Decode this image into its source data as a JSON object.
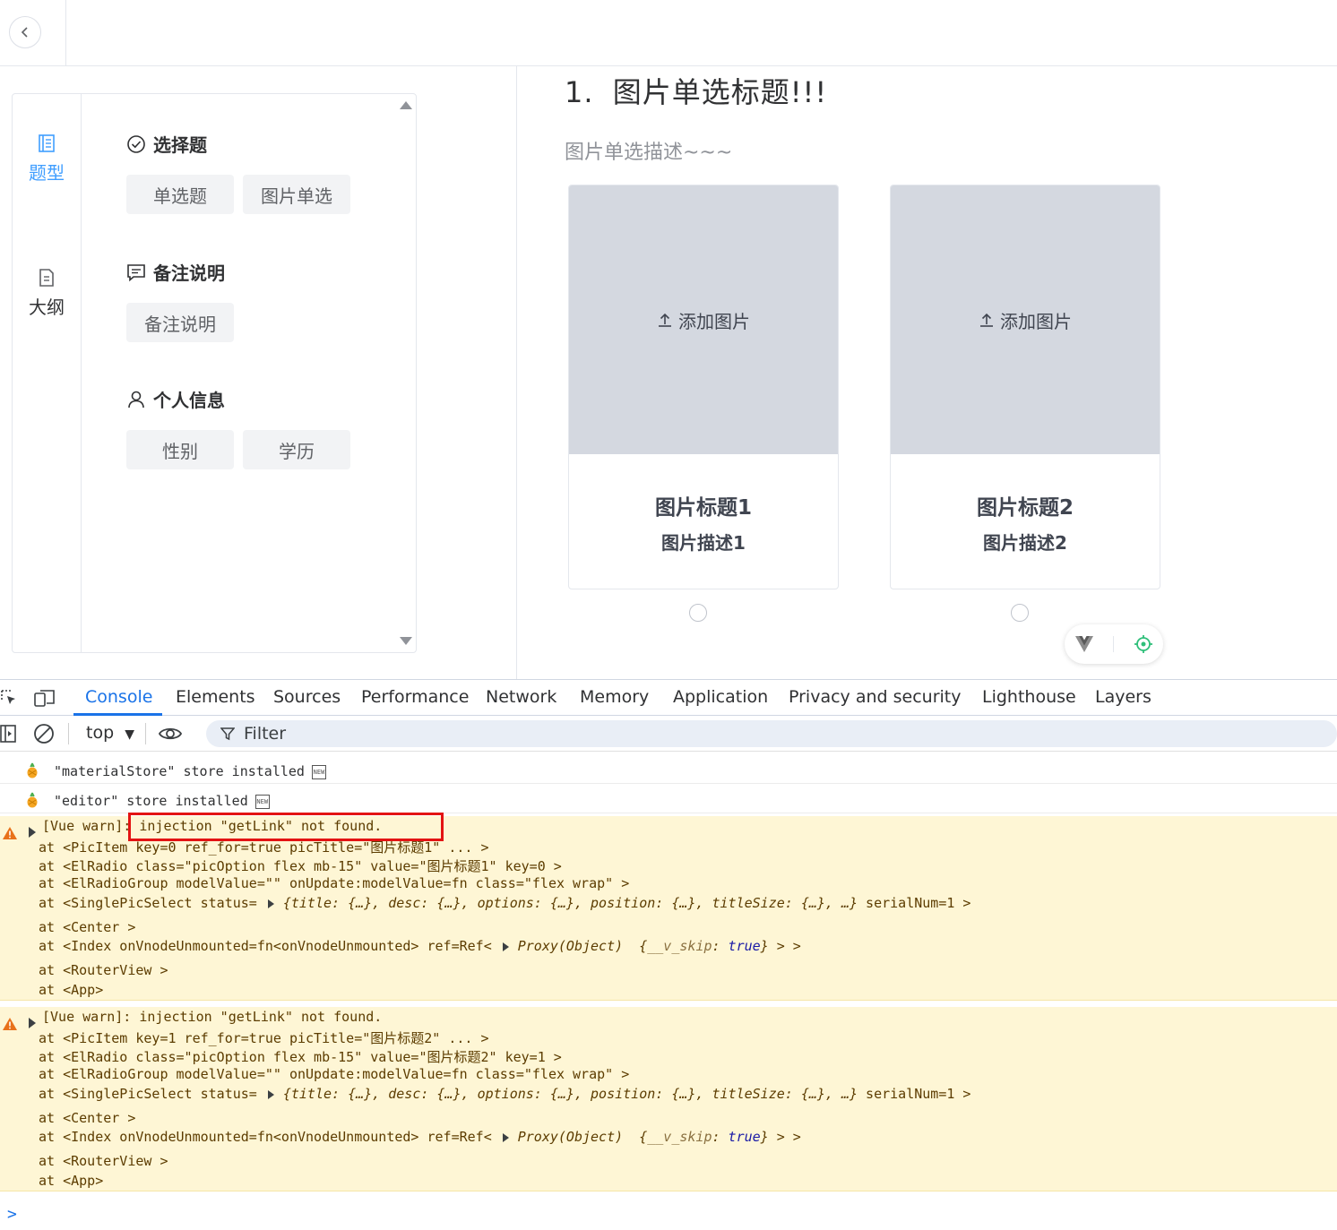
{
  "side_tabs": [
    {
      "label": "题型",
      "icon": "list-icon",
      "active": true
    },
    {
      "label": "大纲",
      "icon": "document-icon",
      "active": false
    }
  ],
  "material_groups": [
    {
      "title": "选择题",
      "icon": "check-circle-icon",
      "items": [
        "单选题",
        "图片单选"
      ]
    },
    {
      "title": "备注说明",
      "icon": "message-icon",
      "items": [
        "备注说明"
      ]
    },
    {
      "title": "个人信息",
      "icon": "user-icon",
      "items": [
        "性别",
        "学历"
      ]
    }
  ],
  "question": {
    "serial": "1.",
    "title": "图片单选标题!!!",
    "desc": "图片单选描述~~~",
    "upload_label": "添加图片",
    "options": [
      {
        "title": "图片标题1",
        "desc": "图片描述1"
      },
      {
        "title": "图片标题2",
        "desc": "图片描述2"
      }
    ]
  },
  "devtools": {
    "tabs": [
      "Console",
      "Elements",
      "Sources",
      "Performance",
      "Network",
      "Memory",
      "Application",
      "Privacy and security",
      "Lighthouse",
      "Layers"
    ],
    "active_tab": "Console",
    "context": "top",
    "filter_placeholder": "Filter",
    "logs": [
      "\"materialStore\" store installed",
      "\"editor\" store installed"
    ],
    "new_badge": "NEW",
    "warnings": [
      {
        "head_prefix": "[Vue warn]: ",
        "head_msg": "injection \"getLink\" not found.",
        "lines": [
          "at <PicItem key=0 ref_for=true picTitle=\"图片标题1\"  ... >",
          "at <ElRadio class=\"picOption flex mb-15\" value=\"图片标题1\" key=0 >",
          "at <ElRadioGroup modelValue=\"\" onUpdate:modelValue=fn class=\"flex wrap\" >"
        ],
        "status_line_prefix": "at <SinglePicSelect status=",
        "status_obj": "{title: {…}, desc: {…}, options: {…}, position: {…}, titleSize: {…},  …}",
        "status_line_suffix": " serialNum=1 >",
        "center_line": "at <Center >",
        "index_prefix": "at <Index onVnodeUnmounted=fn<onVnodeUnmounted> ref=Ref<",
        "index_proxy": "Proxy(Object)",
        "index_skip_key": "__v_skip",
        "index_skip_val": "true",
        "index_suffix": " > >",
        "router_line": "at <RouterView >",
        "app_line": "at <App>"
      },
      {
        "head_prefix": "[Vue warn]: ",
        "head_msg": "injection \"getLink\" not found.",
        "lines": [
          "at <PicItem key=1 ref_for=true picTitle=\"图片标题2\"  ... >",
          "at <ElRadio class=\"picOption flex mb-15\" value=\"图片标题2\" key=1 >",
          "at <ElRadioGroup modelValue=\"\" onUpdate:modelValue=fn class=\"flex wrap\" >"
        ],
        "status_line_prefix": "at <SinglePicSelect status=",
        "status_obj": "{title: {…}, desc: {…}, options: {…}, position: {…}, titleSize: {…},  …}",
        "status_line_suffix": " serialNum=1 >",
        "center_line": "at <Center >",
        "index_prefix": "at <Index onVnodeUnmounted=fn<onVnodeUnmounted> ref=Ref<",
        "index_proxy": "Proxy(Object)",
        "index_skip_key": "__v_skip",
        "index_skip_val": "true",
        "index_suffix": " > >",
        "router_line": "at <RouterView >",
        "app_line": "at <App>"
      }
    ],
    "prompt": ">"
  },
  "colors": {
    "accent": "#409eff",
    "devtools_accent": "#1a73e8",
    "warning_bg": "#fef6d5",
    "highlight": "#e31313"
  }
}
